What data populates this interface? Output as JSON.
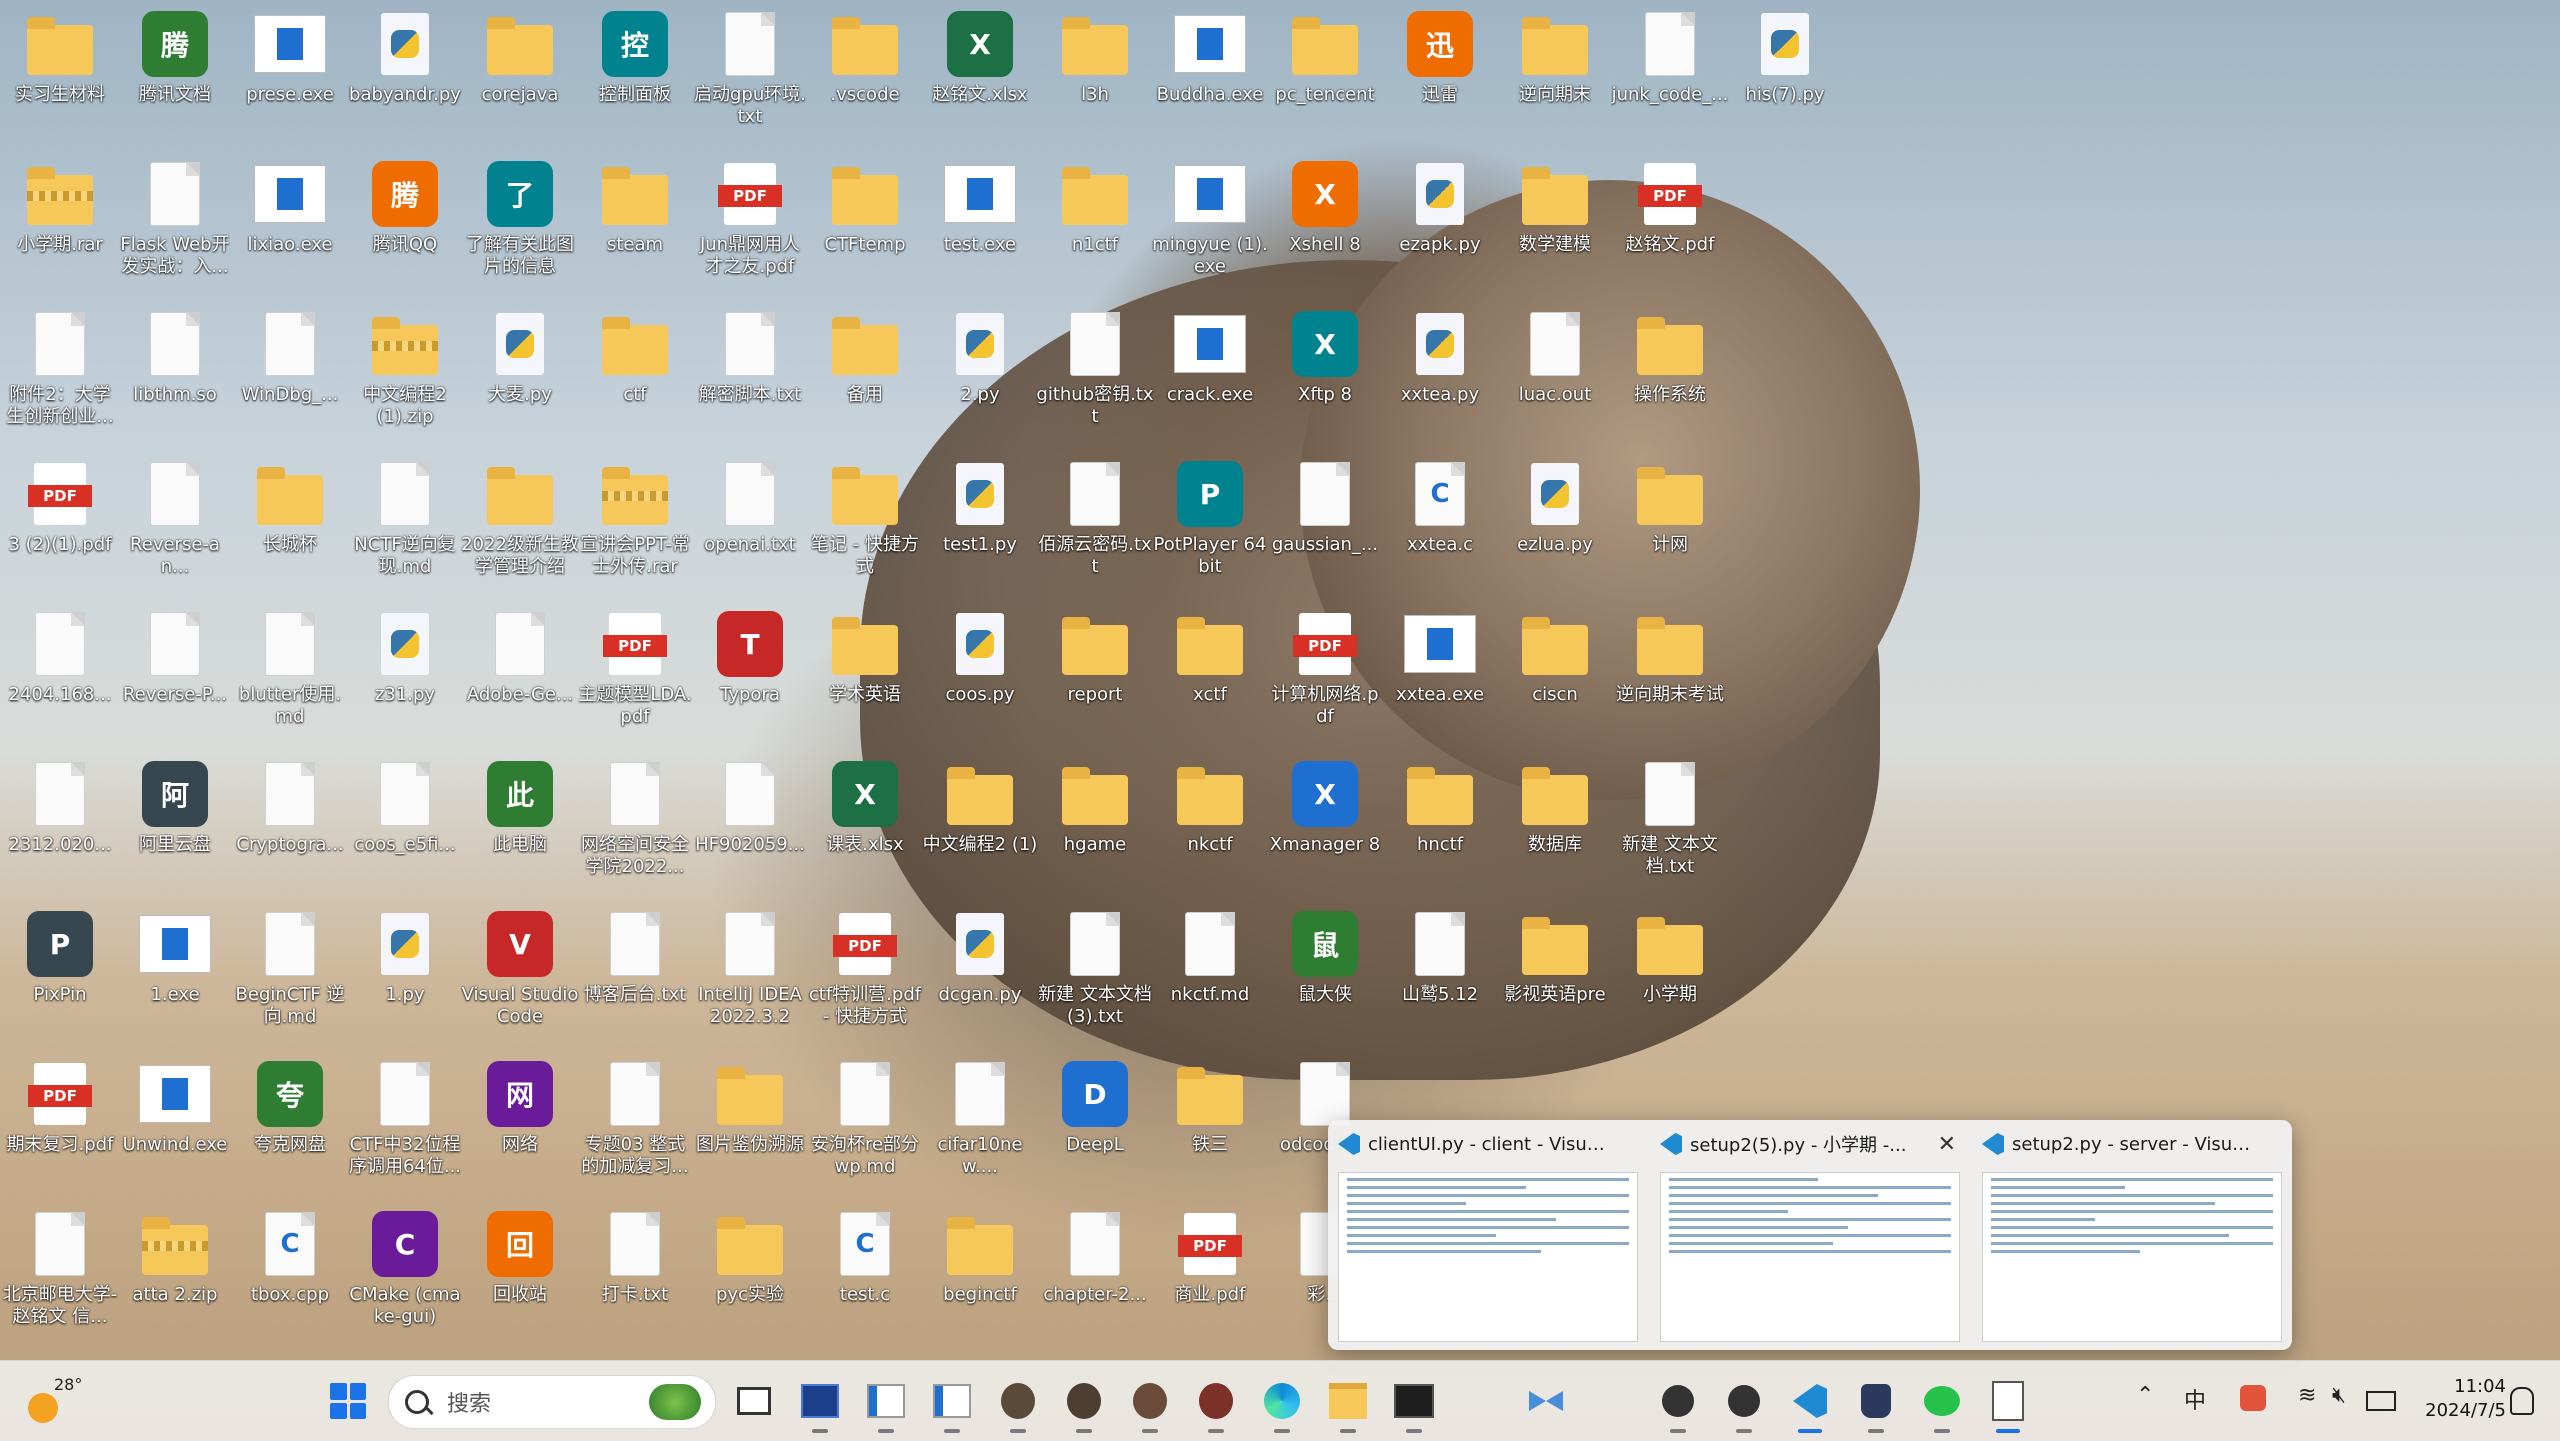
{
  "desktop": {
    "columns": [
      [
        "实习生材料",
        "小学期.rar",
        "附件2：大学生创新创业...",
        "3 (2)(1).pdf",
        "2404.168...",
        "2312.020...",
        "PixPin",
        "期末复习.pdf",
        "北京邮电大学-赵铭文 信..."
      ],
      [
        "腾讯文档",
        "Flask Web开发实战：入...",
        "libthm.so",
        "Reverse-an...",
        "Reverse-P...",
        "阿里云盘",
        "1.exe",
        "Unwind.exe",
        "atta 2.zip"
      ],
      [
        "prese.exe",
        "lixiao.exe",
        "WinDbg_...",
        "长城杯",
        "blutter使用.md",
        "Cryptogra...",
        "BeginCTF 逆向.md",
        "夸克网盘",
        "tbox.cpp"
      ],
      [
        "babyandr.py",
        "腾讯QQ",
        "中文编程2 (1).zip",
        "NCTF逆向复现.md",
        "z31.py",
        "coos_e5fi...",
        "1.py",
        "CTF中32位程序调用64位...",
        "CMake (cmake-gui)"
      ],
      [
        "corejava",
        "了解有关此图片的信息",
        "大麦.py",
        "2022级新生教学管理介绍",
        "Adobe-Ge...",
        "此电脑",
        "Visual Studio Code",
        "网络",
        "回收站"
      ],
      [
        "控制面板",
        "steam",
        "ctf",
        "宣讲会PPT-常士外传.rar",
        "主题模型LDA.pdf",
        "网络空间安全学院2022...",
        "博客后台.txt",
        "专题03 整式的加减复习...",
        "打卡.txt"
      ],
      [
        "启动gpu环境.txt",
        "Jun鼎网用人才之友.pdf",
        "解密脚本.txt",
        "openai.txt",
        "Typora",
        "HF902059...",
        "IntelliJ IDEA 2022.3.2",
        "图片鉴伪溯源",
        "pyc实验"
      ],
      [
        ".vscode",
        "CTFtemp",
        "备用",
        "笔记 - 快捷方式",
        "学术英语",
        "课表.xlsx",
        "ctf特训营.pdf - 快捷方式",
        "安洵杯re部分wp.md",
        "test.c"
      ],
      [
        "赵铭文.xlsx",
        "test.exe",
        "2.py",
        "test1.py",
        "coos.py",
        "中文编程2 (1)",
        "dcgan.py",
        "cifar10new....",
        "beginctf"
      ],
      [
        "l3h",
        "n1ctf",
        "github密钥.txt",
        "佰源云密码.txt",
        "report",
        "hgame",
        "新建 文本文档 (3).txt",
        "DeepL",
        "chapter-2..."
      ],
      [
        "Buddha.exe",
        "mingyue (1).exe",
        "crack.exe",
        "PotPlayer 64 bit",
        "xctf",
        "nkctf",
        "nkctf.md",
        "铁三",
        "商业.pdf"
      ],
      [
        "pc_tencent",
        "Xshell 8",
        "Xftp 8",
        "gaussian_...",
        "计算机网络.pdf",
        "Xmanager 8",
        "鼠大侠",
        "odcod本...",
        "彩..."
      ],
      [
        "迅雷",
        "ezapk.py",
        "xxtea.py",
        "xxtea.c",
        "xxtea.exe",
        "hnctf",
        "山鹫5.12",
        "",
        ""
      ],
      [
        "逆向期末",
        "数学建模",
        "luac.out",
        "ezlua.py",
        "ciscn",
        "数据库",
        "影视英语pre",
        "",
        ""
      ],
      [
        "junk_code_...",
        "赵铭文.pdf",
        "操作系统",
        "计网",
        "逆向期末考试",
        "新建 文本文档.txt",
        "小学期",
        "",
        ""
      ],
      [
        "his(7).py",
        "",
        "",
        "",
        "",
        "",
        "",
        "",
        ""
      ]
    ]
  },
  "taskbar_popup": {
    "windows": [
      {
        "title": "clientUI.py - client - Visual St...",
        "app_icon": "vscode-icon"
      },
      {
        "title": "setup2(5).py - 小学期 -...",
        "app_icon": "vscode-icon",
        "close": "✕"
      },
      {
        "title": "setup2.py - server - Visual St...",
        "app_icon": "vscode-icon"
      }
    ]
  },
  "taskbar": {
    "weather_temp": "28°",
    "search_placeholder": "搜索",
    "tray_ime": "中",
    "clock_time": "11:04",
    "clock_date": "2024/7/5"
  },
  "colors": {
    "folder": "#f6c85a",
    "pdf_red": "#d93025",
    "vscode_blue": "#1f8ad2",
    "accent": "#1a73e8"
  }
}
